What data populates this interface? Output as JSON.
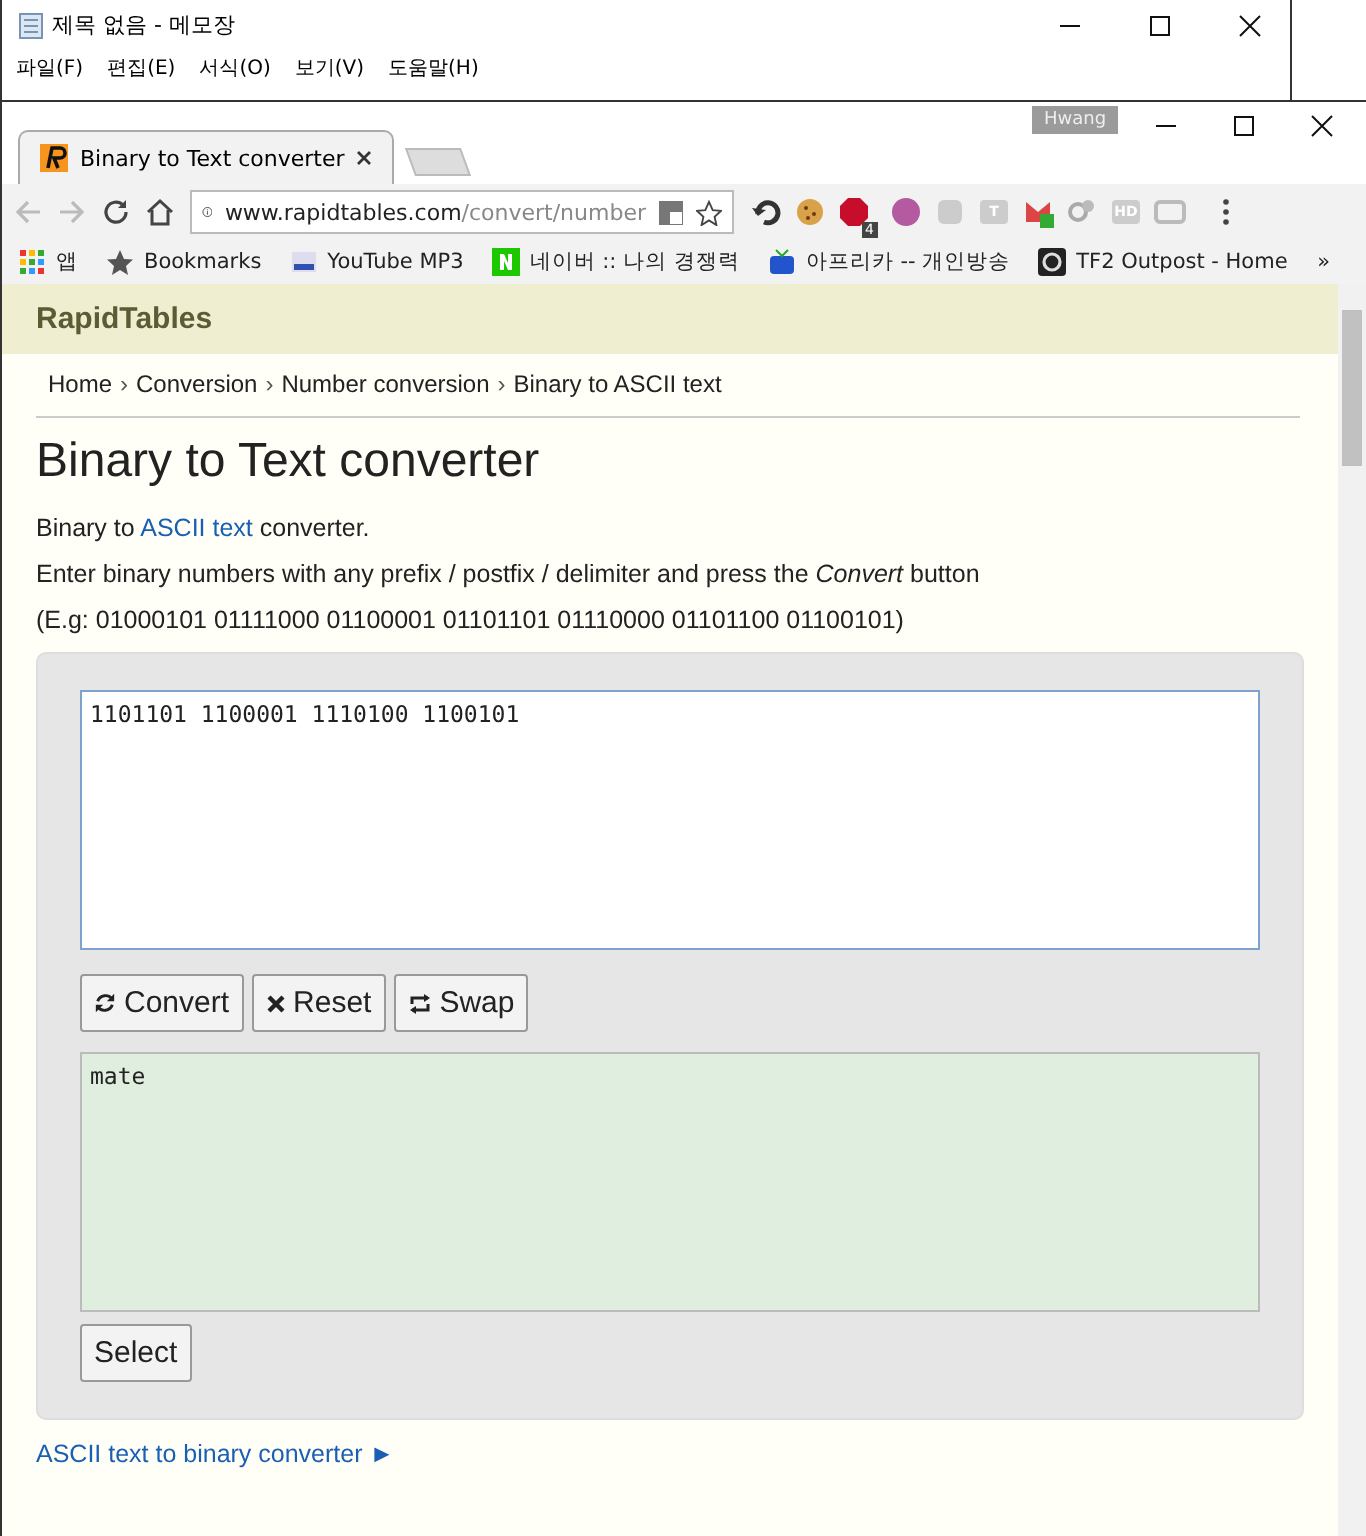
{
  "notepad": {
    "title": "제목 없음 - 메모장",
    "menu": [
      "파일(F)",
      "편집(E)",
      "서식(O)",
      "보기(V)",
      "도움말(H)"
    ]
  },
  "browser": {
    "profile": "Hwang",
    "tabs": [
      {
        "title": "Binary to Text converter",
        "selected": true
      }
    ],
    "url": {
      "host": "www.rapidtables.com",
      "path": "/convert/number"
    },
    "extensions": [
      {
        "kind": "undo"
      },
      {
        "kind": "cookie"
      },
      {
        "kind": "abp",
        "badge": "4"
      },
      {
        "kind": "osu"
      },
      {
        "kind": "grey"
      },
      {
        "kind": "letter",
        "label": "T"
      },
      {
        "kind": "mail"
      },
      {
        "kind": "puzzle"
      },
      {
        "kind": "letter",
        "label": "HD"
      },
      {
        "kind": "swap"
      }
    ],
    "bookmarks": [
      {
        "kind": "apps",
        "label": "앱"
      },
      {
        "kind": "star",
        "label": "Bookmarks"
      },
      {
        "kind": "yt",
        "label": "YouTube MP3"
      },
      {
        "kind": "naver",
        "label": "네이버 :: 나의 경쟁력"
      },
      {
        "kind": "tv",
        "label": "아프리카 -- 개인방송"
      },
      {
        "kind": "tf2",
        "label": "TF2 Outpost - Home"
      }
    ],
    "bookmarks_more": "»"
  },
  "page": {
    "site_name": "RapidTables",
    "breadcrumb_separator": "›",
    "breadcrumbs": [
      "Home",
      "Conversion",
      "Number conversion",
      "Binary to ASCII text"
    ],
    "title": "Binary to Text converter",
    "intro": {
      "before": "Binary to ",
      "link": "ASCII text",
      "after": " converter."
    },
    "instruction": "Enter binary numbers with any prefix / postfix / delimiter and press the *Convert* button",
    "example": "(E.g: 01000101 01111000 01100001 01101101 01110000 01101100 01100101)",
    "input": "1101101 1100001 1110100 1100101",
    "buttons": [
      {
        "kind": "refresh",
        "label": "Convert"
      },
      {
        "kind": "cross",
        "label": "Reset"
      },
      {
        "kind": "swap",
        "label": "Swap"
      }
    ],
    "output": "mate",
    "select_button": "Select",
    "footer_link": "ASCII text to binary converter ►"
  }
}
